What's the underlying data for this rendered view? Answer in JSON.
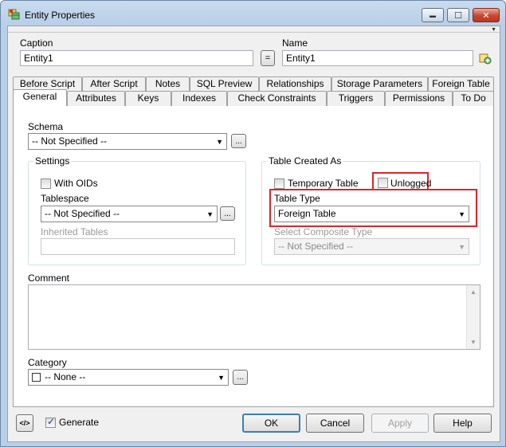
{
  "window": {
    "title": "Entity Properties",
    "min_glyph": "▬",
    "max_glyph": "☐",
    "close_glyph": "✕"
  },
  "header": {
    "caption_label": "Caption",
    "caption_value": "Entity1",
    "equals_label": "=",
    "name_label": "Name",
    "name_value": "Entity1"
  },
  "tabs_back": [
    "Before Script",
    "After Script",
    "Notes",
    "SQL Preview",
    "Relationships",
    "Storage Parameters",
    "Foreign Table"
  ],
  "tabs_front": [
    "General",
    "Attributes",
    "Keys",
    "Indexes",
    "Check Constraints",
    "Triggers",
    "Permissions",
    "To Do"
  ],
  "general": {
    "schema_label": "Schema",
    "schema_value": "-- Not Specified --",
    "ellipsis": "...",
    "settings": {
      "title": "Settings",
      "with_oids_label": "With OIDs",
      "with_oids_checked": false,
      "tablespace_label": "Tablespace",
      "tablespace_value": "-- Not Specified --",
      "inherited_label": "Inherited Tables",
      "inherited_value": ""
    },
    "table_created": {
      "title": "Table Created As",
      "temporary_label": "Temporary Table",
      "temporary_checked": false,
      "unlogged_label": "Unlogged",
      "unlogged_checked": false,
      "table_type_label": "Table Type",
      "table_type_value": "Foreign Table",
      "composite_label": "Select Composite Type",
      "composite_value": "-- Not Specified --"
    },
    "comment_label": "Comment",
    "comment_value": "",
    "category_label": "Category",
    "category_value": "-- None --"
  },
  "footer": {
    "generate_label": "Generate",
    "generate_checked": true,
    "ok": "OK",
    "cancel": "Cancel",
    "apply": "Apply",
    "help": "Help"
  },
  "colors": {
    "highlight_border": "#d9262a",
    "title_gradient": "#c9dbee"
  }
}
